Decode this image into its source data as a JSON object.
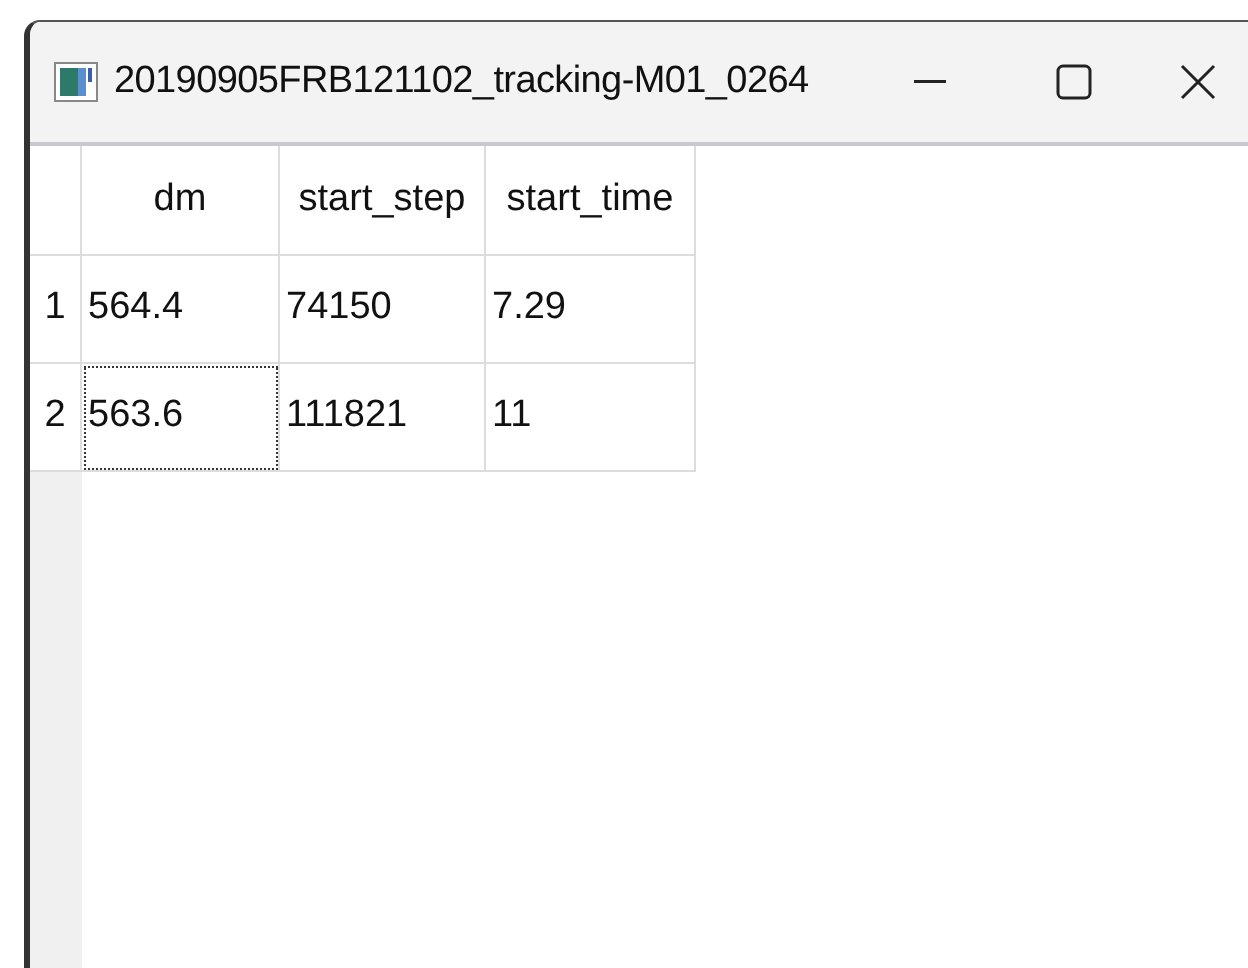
{
  "window": {
    "title": "20190905FRB121102_tracking-M01_0264"
  },
  "table": {
    "columns": [
      "dm",
      "start_step",
      "start_time"
    ],
    "rows": [
      {
        "header": "1",
        "cells": [
          {
            "text": "564.4",
            "focused": false
          },
          {
            "text": "74150",
            "focused": false
          },
          {
            "text": "7.29",
            "focused": false
          }
        ]
      },
      {
        "header": "2",
        "cells": [
          {
            "text": "563.6",
            "focused": true
          },
          {
            "text": "111821",
            "focused": false
          },
          {
            "text": "11",
            "focused": false
          }
        ]
      }
    ]
  }
}
